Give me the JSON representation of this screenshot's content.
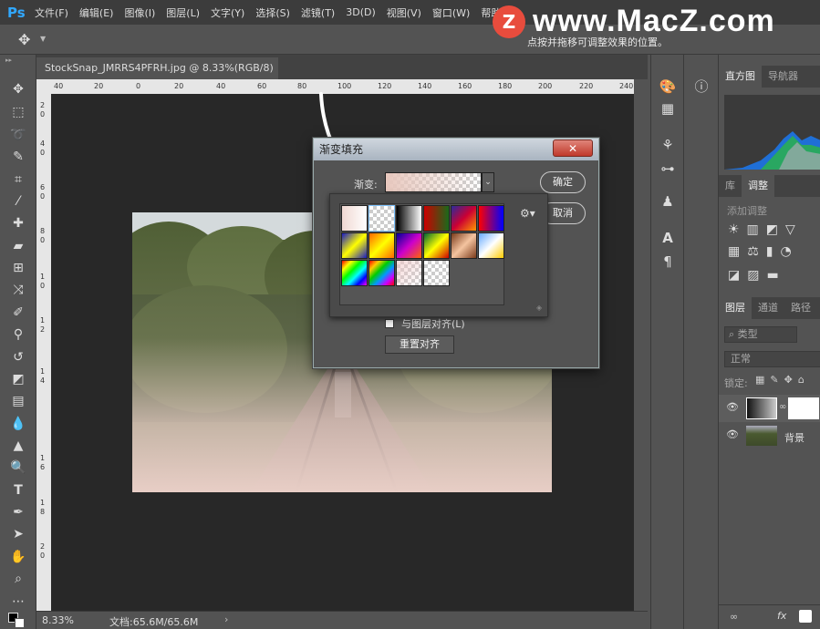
{
  "app": {
    "logo": "Ps"
  },
  "menu": [
    "文件(F)",
    "编辑(E)",
    "图像(I)",
    "图层(L)",
    "文字(Y)",
    "选择(S)",
    "滤镜(T)",
    "3D(D)",
    "视图(V)",
    "窗口(W)",
    "帮助(H)"
  ],
  "watermark": {
    "badge": "Z",
    "text": "www.MacZ.com"
  },
  "options_bar": {
    "hint": "点按并拖移可调整效果的位置。"
  },
  "document": {
    "tab_title": "StockSnap_JMRRS4PFRH.jpg @ 8.33%(RGB/8)",
    "close": "×"
  },
  "ruler_h": [
    "40",
    "20",
    "0",
    "20",
    "40",
    "60",
    "80",
    "100",
    "120",
    "140",
    "160",
    "180",
    "200",
    "220",
    "240"
  ],
  "ruler_v": [
    "2",
    "0",
    "4",
    "0",
    "6",
    "0",
    "8",
    "0",
    "1",
    "0",
    "1",
    "2",
    "1",
    "4",
    "1",
    "6",
    "1",
    "8",
    "2",
    "0"
  ],
  "status": {
    "zoom": "8.33%",
    "doc_info": "文档:65.6M/65.6M",
    "arrow": "›"
  },
  "dialog": {
    "title": "渐变填充",
    "gradient_label": "渐变:",
    "ok": "确定",
    "cancel": "取消",
    "align_label": "与图层对齐(L)",
    "reset_align": "重置对齐",
    "close": "✕"
  },
  "panels": {
    "top_tabs": [
      "直方图",
      "导航器"
    ],
    "mid_tabs": [
      "库",
      "调整"
    ],
    "adjust_label": "添加调整",
    "layer_tabs": [
      "图层",
      "通道",
      "路径"
    ],
    "filter_label": "类型",
    "blend_mode": "正常",
    "lock_label": "锁定:",
    "layers": [
      {
        "name": "",
        "type": "gradient-fill"
      },
      {
        "name": "背景",
        "type": "image"
      }
    ],
    "footer": [
      "fx"
    ]
  },
  "colors": {
    "accent": "#31a8ff",
    "bg_dark": "#282828",
    "panel": "#535353"
  }
}
